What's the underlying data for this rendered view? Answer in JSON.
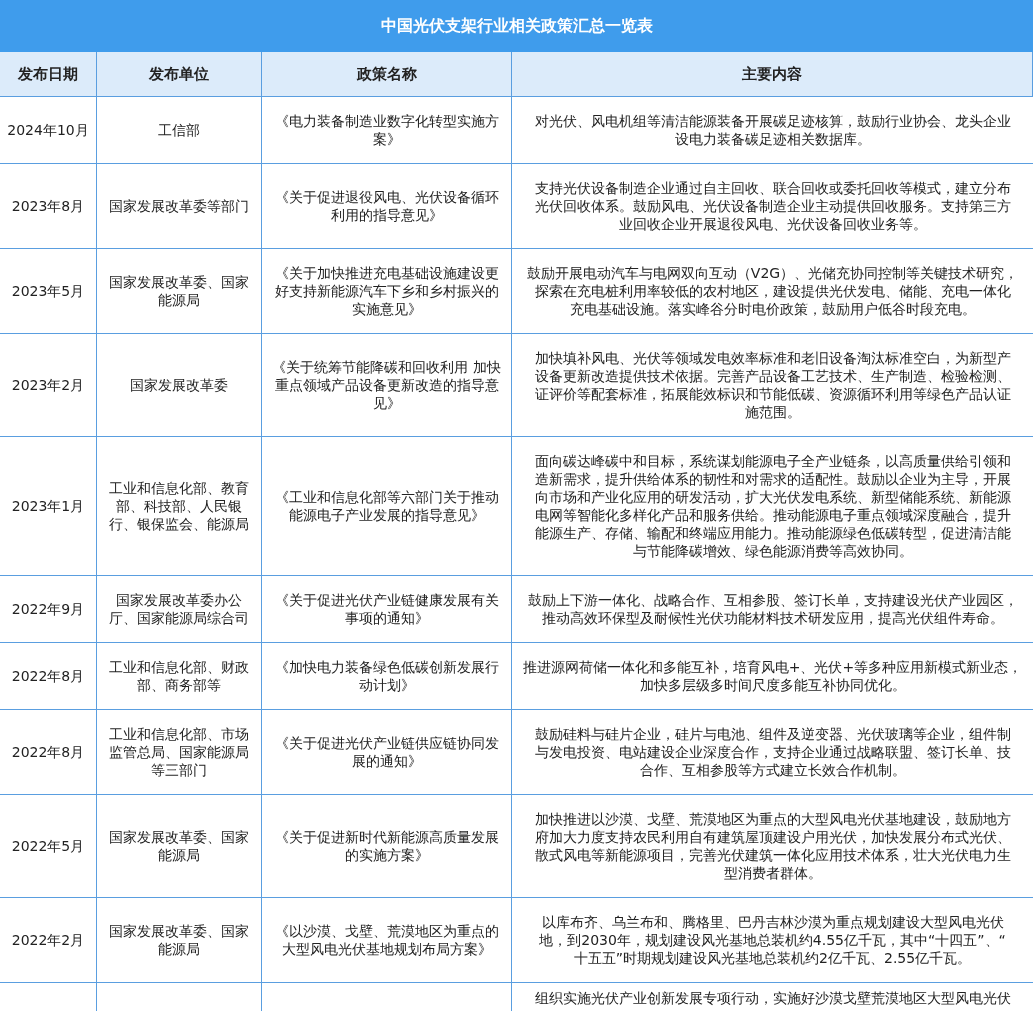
{
  "title": "中国光伏支架行业相关政策汇总一览表",
  "columns": [
    "发布日期",
    "发布单位",
    "政策名称",
    "主要内容"
  ],
  "rows": [
    {
      "date": "2024年10月",
      "publisher": "工信部",
      "policy": "《电力装备制造业数字化转型实施方案》",
      "content": [
        "对光伏、风电机组等清洁能源装备开展碳足迹核算，鼓励行业协会、龙头企业",
        "设电力装备碳足迹相关数据库。"
      ]
    },
    {
      "date": "2023年8月",
      "publisher": "国家发展改革委等部门",
      "policy": "《关于促进退役风电、光伏设备循环利用的指导意见》",
      "content": [
        "支持光伏设备制造企业通过自主回收、联合回收或委托回收等模式，建立分布",
        "光伏回收体系。鼓励风电、光伏设备制造企业主动提供回收服务。支持第三方",
        "业回收企业开展退役风电、光伏设备回收业务等。"
      ]
    },
    {
      "date": "2023年5月",
      "publisher": "国家发展改革委、国家能源局",
      "policy": "《关于加快推进充电基础设施建设更好支持新能源汽车下乡和乡村振兴的实施意见》",
      "content": [
        "鼓励开展电动汽车与电网双向互动（V2G）、光储充协同控制等关键技术研究，",
        "探索在充电桩利用率较低的农村地区，建设提供光伏发电、储能、充电一体化",
        "充电基础设施。落实峰谷分时电价政策，鼓励用户低谷时段充电。"
      ]
    },
    {
      "date": "2023年2月",
      "publisher": "国家发展改革委",
      "policy": "《关于统筹节能降碳和回收利用 加快重点领域产品设备更新改造的指导意见》",
      "content": [
        "加快填补风电、光伏等领域发电效率标准和老旧设备淘汰标准空白，为新型产",
        "设备更新改造提供技术依据。完善产品设备工艺技术、生产制造、检验检测、",
        "证评价等配套标准，拓展能效标识和节能低碳、资源循环利用等绿色产品认证",
        "施范围。"
      ]
    },
    {
      "date": "2023年1月",
      "publisher": "工业和信息化部、教育部、科技部、人民银行、银保监会、能源局",
      "policy": "《工业和信息化部等六部门关于推动能源电子产业发展的指导意见》",
      "content": [
        "面向碳达峰碳中和目标，系统谋划能源电子全产业链条，以高质量供给引领和",
        "造新需求，提升供给体系的韧性和对需求的适配性。鼓励以企业为主导，开展",
        "向市场和产业化应用的研发活动，扩大光伏发电系统、新型储能系统、新能源",
        "电网等智能化多样化产品和服务供给。推动能源电子重点领域深度融合，提升",
        "能源生产、存储、输配和终端应用能力。推动能源绿色低碳转型，促进清洁能",
        "与节能降碳增效、绿色能源消费等高效协同。"
      ]
    },
    {
      "date": "2022年9月",
      "publisher": "国家发展改革委办公厅、国家能源局综合司",
      "policy": "《关于促进光伏产业链健康发展有关事项的通知》",
      "content": [
        "鼓励上下游一体化、战略合作、互相参股、签订长单，支持建设光伏产业园区，",
        "推动高效环保型及耐候性光伏功能材料技术研发应用，提高光伏组件寿命。"
      ]
    },
    {
      "date": "2022年8月",
      "publisher": "工业和信息化部、财政部、商务部等",
      "policy": "《加快电力装备绿色低碳创新发展行动计划》",
      "content": [
        "推进源网荷储一体化和多能互补，培育风电+、光伏+等多种应用新模式新业态，",
        "加快多层级多时间尺度多能互补协同优化。"
      ]
    },
    {
      "date": "2022年8月",
      "publisher": "工业和信息化部、市场监管总局、国家能源局等三部门",
      "policy": "《关于促进光伏产业链供应链协同发展的通知》",
      "content": [
        "鼓励硅料与硅片企业，硅片与电池、组件及逆变器、光伏玻璃等企业，组件制",
        "与发电投资、电站建设企业深度合作，支持企业通过战略联盟、签订长单、技",
        "合作、互相参股等方式建立长效合作机制。"
      ]
    },
    {
      "date": "2022年5月",
      "publisher": "国家发展改革委、国家能源局",
      "policy": "《关于促进新时代新能源高质量发展的实施方案》",
      "content": [
        "加快推进以沙漠、戈壁、荒漠地区为重点的大型风电光伏基地建设，鼓励地方",
        "府加大力度支持农民利用自有建筑屋顶建设户用光伏，加快发展分布式光伏、",
        "散式风电等新能源项目，完善光伏建筑一体化应用技术体系，壮大光伏电力生",
        "型消费者群体。"
      ]
    },
    {
      "date": "2022年2月",
      "publisher": "国家发展改革委、国家能源局",
      "policy": "《以沙漠、戈壁、荒漠地区为重点的大型风电光伏基地规划布局方案》",
      "content": [
        "以库布齐、乌兰布和、腾格里、巴丹吉林沙漠为重点规划建设大型风电光伏",
        "地，到2030年，规划建设风光基地总装机约4.55亿千瓦，其中“十四五”、“",
        "十五五”时期规划建设风光基地总装机约2亿千瓦、2.55亿千瓦。"
      ]
    },
    {
      "content": [
        "组织实施光伏产业创新发展专项行动，实施好沙漠戈壁荒漠地区大型风电光伏"
      ]
    }
  ]
}
